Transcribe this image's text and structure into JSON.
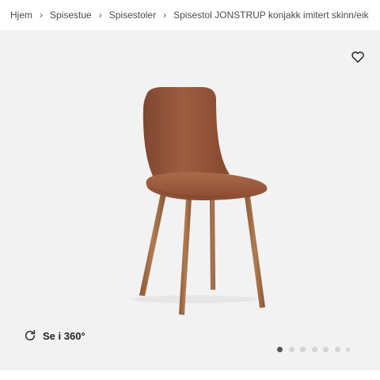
{
  "breadcrumb": {
    "items": [
      "Hjem",
      "Spisestue",
      "Spisestoler",
      "Spisestol JONSTRUP konjakk imitert skinn/eik"
    ]
  },
  "gallery": {
    "view360_label": "Se i 360°",
    "image_count": 7,
    "active_index": 0
  },
  "icons": {
    "wishlist": "heart-outline-icon",
    "rotate": "rotate-icon",
    "separator": "chevron-right-icon"
  },
  "colors": {
    "gallery_bg": "#f2f2f2",
    "leather": "#9a5a3c",
    "wood_legs": "#9e6a43",
    "dot_active": "#555555",
    "dot_inactive": "#d4d4d4"
  }
}
